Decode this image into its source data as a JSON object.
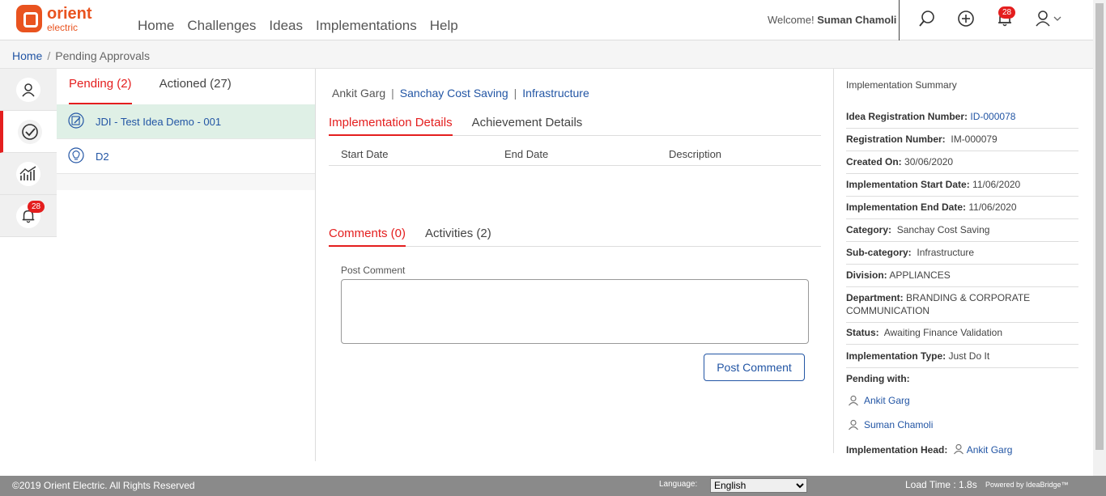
{
  "brand": {
    "name": "orient",
    "sub": "electric",
    "color": "#e9531f"
  },
  "nav": {
    "items": [
      "Home",
      "Challenges",
      "Ideas",
      "Implementations",
      "Help"
    ]
  },
  "header": {
    "welcome": "Welcome!",
    "user": "Suman Chamoli",
    "notif_count": "28"
  },
  "breadcrumb": {
    "home": "Home",
    "sep": "/",
    "current": "Pending Approvals"
  },
  "rail": {
    "notif_count": "28"
  },
  "list": {
    "tabs": [
      {
        "label": "Pending (2)"
      },
      {
        "label": "Actioned (27)"
      }
    ],
    "items": [
      {
        "label": "JDI - Test Idea Demo - 001"
      },
      {
        "label": "D2"
      }
    ]
  },
  "detail": {
    "owner": "Ankit Garg",
    "category": "Sanchay Cost Saving",
    "subcategory": "Infrastructure",
    "tabs": [
      {
        "label": "Implementation Details"
      },
      {
        "label": "Achievement Details"
      }
    ],
    "columns": [
      "Start Date",
      "End Date",
      "Description"
    ],
    "comment_tabs": [
      {
        "label": "Comments (0)"
      },
      {
        "label": "Activities (2)"
      }
    ],
    "post_label": "Post Comment",
    "post_button": "Post Comment"
  },
  "summary": {
    "title": "Implementation Summary",
    "idea_reg_label": "Idea Registration Number:",
    "idea_reg": "ID-000078",
    "reg_label": "Registration Number:",
    "reg": "IM-000079",
    "created_label": "Created On:",
    "created": "30/06/2020",
    "start_label": "Implementation Start Date:",
    "start": "11/06/2020",
    "end_label": "Implementation End Date:",
    "end": "11/06/2020",
    "cat_label": "Category:",
    "cat": "Sanchay Cost Saving",
    "subcat_label": "Sub-category:",
    "subcat": "Infrastructure",
    "div_label": "Division:",
    "div": "APPLIANCES",
    "dept_label": "Department:",
    "dept": "BRANDING & CORPORATE COMMUNICATION",
    "status_label": "Status:",
    "status": "Awaiting Finance Validation",
    "type_label": "Implementation Type:",
    "type": "Just Do It",
    "pending_label": "Pending with:",
    "pending": [
      "Ankit Garg",
      "Suman Chamoli"
    ],
    "head_label": "Implementation Head:",
    "head": "Ankit Garg"
  },
  "footer": {
    "copyright": "©2019 Orient Electric. All Rights Reserved",
    "language_label": "Language:",
    "language": "English",
    "load_time": "Load Time : 1.8s",
    "powered": "Powered by IdeaBridge™"
  }
}
